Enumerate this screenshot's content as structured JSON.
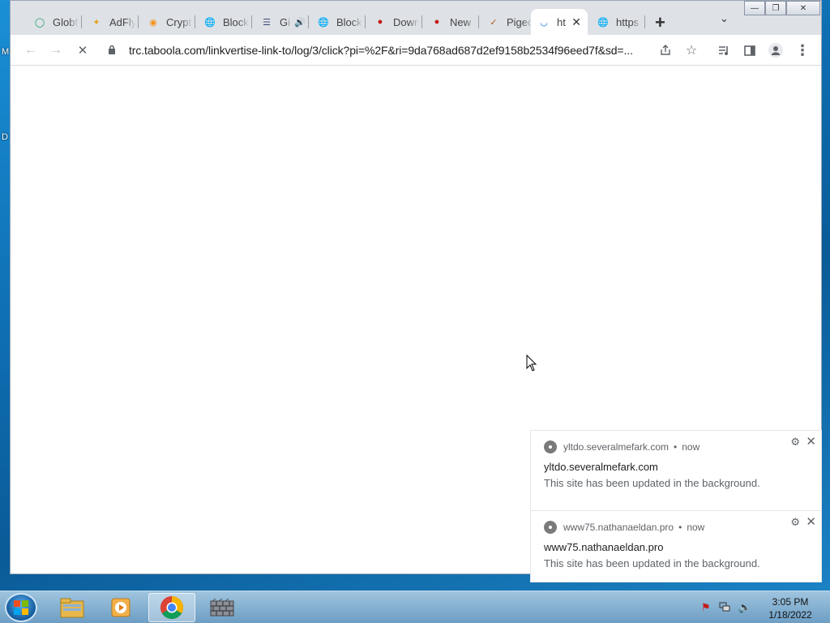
{
  "desktop": {
    "glyph_m": "M",
    "glyph_d": "D"
  },
  "tabs": [
    {
      "title": "Globf",
      "icon": "globe-q-icon",
      "color": "#1fa463"
    },
    {
      "title": "AdFly",
      "icon": "adfly-bee-icon",
      "color": "#e3a21a"
    },
    {
      "title": "Crypt",
      "icon": "crypto-coin-icon",
      "color": "#f7931a"
    },
    {
      "title": "Block",
      "icon": "globe-icon",
      "color": "#5f6368"
    },
    {
      "title": "Gi",
      "icon": "flag-icon",
      "color": "#3c4a7a",
      "audio": true
    },
    {
      "title": "Block",
      "icon": "globe-icon",
      "color": "#5f6368"
    },
    {
      "title": "Down",
      "icon": "among-us-icon",
      "color": "#c51111"
    },
    {
      "title": "New",
      "icon": "among-us-icon",
      "color": "#c51111"
    },
    {
      "title": "Pigeo",
      "icon": "pigeon-icon",
      "color": "#b85c1a"
    },
    {
      "title": "ht",
      "icon": "loading-spinner-icon",
      "color": "#1a73e8",
      "active": true
    },
    {
      "title": "https",
      "icon": "globe-icon",
      "color": "#5f6368"
    }
  ],
  "toolbar": {
    "url": "trc.taboola.com/linkvertise-link-to/log/3/click?pi=%2F&ri=9da768ad687d2ef9158b2534f96eed7f&sd=..."
  },
  "notifications": [
    {
      "origin": "yltdo.severalmefark.com",
      "time": "now",
      "title": "yltdo.severalmefark.com",
      "body": "This site has been updated in the background."
    },
    {
      "origin": "www75.nathanaeldan.pro",
      "time": "now",
      "title": "www75.nathanaeldan.pro",
      "body": "This site has been updated in the background."
    }
  ],
  "taskbar": {
    "apps": [
      "explorer-folder-icon",
      "media-player-icon",
      "chrome-icon",
      "firewall-icon"
    ],
    "time": "3:05 PM",
    "date": "1/18/2022"
  }
}
